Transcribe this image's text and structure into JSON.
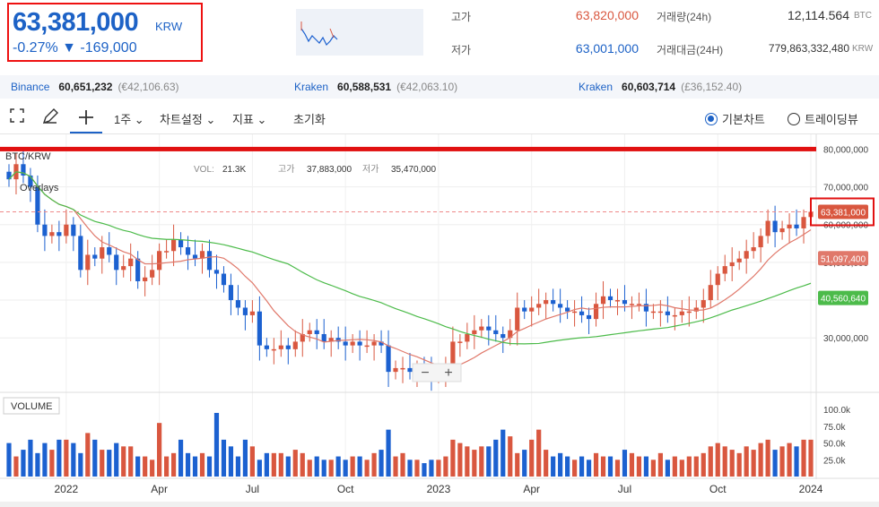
{
  "header": {
    "price": "63,381,000",
    "unit": "KRW",
    "change": "-0.27% ▼ -169,000",
    "stats": {
      "high_label": "고가",
      "high_value": "63,820,000",
      "low_label": "저가",
      "low_value": "63,001,000",
      "volume_label": "거래량(24h)",
      "volume_value": "12,114.564",
      "volume_unit": "BTC",
      "amount_label": "거래대금(24H)",
      "amount_value": "779,863,332,480",
      "amount_unit": "KRW"
    }
  },
  "exchanges": [
    {
      "name": "Binance",
      "value": "60,651,232",
      "usd": "(€42,106.63)"
    },
    {
      "name": "Kraken",
      "value": "60,588,531",
      "usd": "(€42,063.10)"
    },
    {
      "name": "Kraken",
      "value": "60,603,714",
      "usd": "(£36,152.40)"
    }
  ],
  "toolbar": {
    "interval": "1주 ⌄",
    "chart_settings": "차트설정 ⌄",
    "indicators": "지표 ⌄",
    "reset": "초기화",
    "basic_chart": "기본차트",
    "trading_view": "트레이딩뷰"
  },
  "colors": {
    "up": "#d9573f",
    "down": "#1c61d0",
    "ma_short": "#e0786a",
    "ma_long": "#4cbb4a",
    "accent": "#1d62c6",
    "highlight": "#e11111"
  },
  "chart_data": {
    "type": "candlestick",
    "symbol": "BTC/KRW",
    "legend_lines": [
      {
        "k1": "VOL:",
        "v1": "21.3K",
        "k2": "고가",
        "v2": "37,883,000",
        "k3": "저가",
        "v3": "35,470,000"
      }
    ],
    "overlays_label": "Overlays",
    "volume_label": "VOLUME",
    "x_ticks": [
      "2022",
      "Apr",
      "Jul",
      "Oct",
      "2023",
      "Apr",
      "Jul",
      "Oct",
      "2024"
    ],
    "x_tick_positions_week": [
      8,
      21,
      34,
      47,
      60,
      73,
      86,
      99,
      112
    ],
    "y_ticks": [
      30000000,
      40000000,
      50000000,
      60000000,
      70000000,
      80000000
    ],
    "y_tick_labels": [
      "30,000,000",
      "40,000,000",
      "50,000,000",
      "60,000,000",
      "70,000,000",
      "80,000,000"
    ],
    "ylim": [
      17000000,
      82000000
    ],
    "volume_ticks": [
      25000,
      50000,
      75000,
      100000
    ],
    "volume_tick_labels": [
      "25.0k",
      "50.0k",
      "75.0k",
      "100.0k"
    ],
    "volume_ylim": [
      0,
      115000
    ],
    "badges": {
      "current": {
        "value": 63381000,
        "label": "63,381,000"
      },
      "ma_short": {
        "value": 51097400,
        "label": "51,097,400"
      },
      "ma_long": {
        "value": 40560640,
        "label": "40,560,640"
      }
    },
    "highlight_line_value": 80000000,
    "dashed_line_value": 63381000,
    "close": [
      72,
      76,
      73,
      70,
      60,
      57,
      58,
      57,
      60,
      57,
      48,
      52,
      51,
      54,
      52,
      48,
      49,
      51,
      45,
      46,
      48,
      53,
      53,
      56,
      54,
      52,
      51,
      53,
      48,
      47,
      44,
      40,
      38,
      36,
      37,
      28,
      27,
      27,
      28,
      27,
      29,
      31,
      32,
      31,
      29,
      30,
      29,
      28,
      29,
      28,
      28,
      29,
      28,
      21,
      22,
      22,
      21,
      22,
      21,
      20,
      21,
      22,
      29,
      29,
      31,
      32,
      33,
      32,
      31,
      30,
      32,
      38,
      37,
      38,
      39,
      40,
      39,
      38,
      37,
      37,
      36,
      35,
      39,
      41,
      40,
      40,
      39,
      39,
      39,
      37,
      37,
      37,
      36,
      36,
      37,
      37,
      38,
      40,
      44,
      47,
      49,
      50,
      51,
      53,
      54,
      57,
      61,
      58,
      59,
      60,
      59,
      62,
      63.38
    ],
    "volume": [
      50,
      30,
      40,
      55,
      35,
      50,
      40,
      55,
      55,
      50,
      35,
      65,
      55,
      40,
      40,
      50,
      45,
      45,
      30,
      30,
      25,
      80,
      30,
      35,
      55,
      35,
      30,
      35,
      30,
      95,
      55,
      45,
      30,
      55,
      45,
      25,
      35,
      35,
      35,
      30,
      40,
      35,
      25,
      30,
      25,
      25,
      30,
      25,
      30,
      30,
      25,
      35,
      40,
      70,
      30,
      35,
      25,
      25,
      20,
      25,
      25,
      30,
      55,
      50,
      45,
      40,
      45,
      45,
      55,
      70,
      60,
      35,
      40,
      55,
      70,
      40,
      30,
      35,
      30,
      25,
      30,
      25,
      35,
      30,
      30,
      25,
      40,
      35,
      30,
      30,
      25,
      35,
      25,
      30,
      25,
      30,
      30,
      35,
      45,
      50,
      45,
      40,
      35,
      45,
      40,
      50,
      55,
      40,
      45,
      50,
      45,
      55,
      55
    ]
  }
}
